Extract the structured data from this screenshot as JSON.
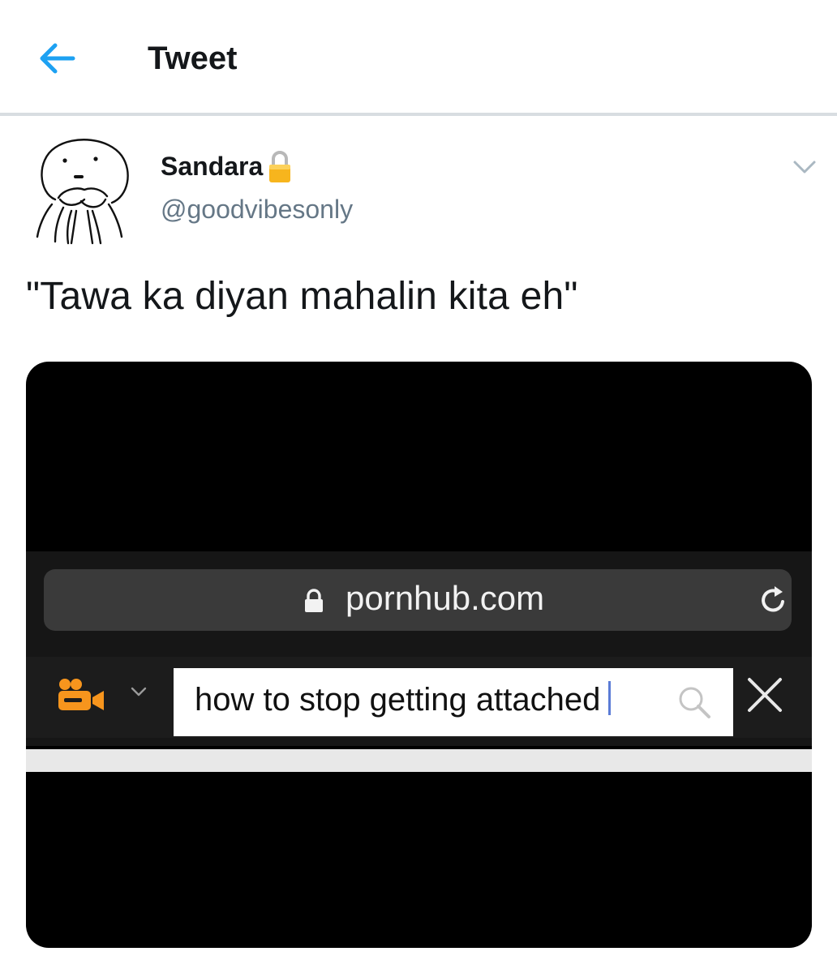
{
  "header": {
    "title": "Tweet"
  },
  "tweet": {
    "display_name": "Sandara",
    "handle": "@goodvibesonly",
    "text": "\"Tawa ka diyan mahalin kita eh\""
  },
  "media": {
    "url": "pornhub.com",
    "search_query": "how to stop getting attached"
  },
  "colors": {
    "accent": "#1da1f2",
    "secondary_text": "#657786",
    "brand_orange": "#f7951d"
  }
}
